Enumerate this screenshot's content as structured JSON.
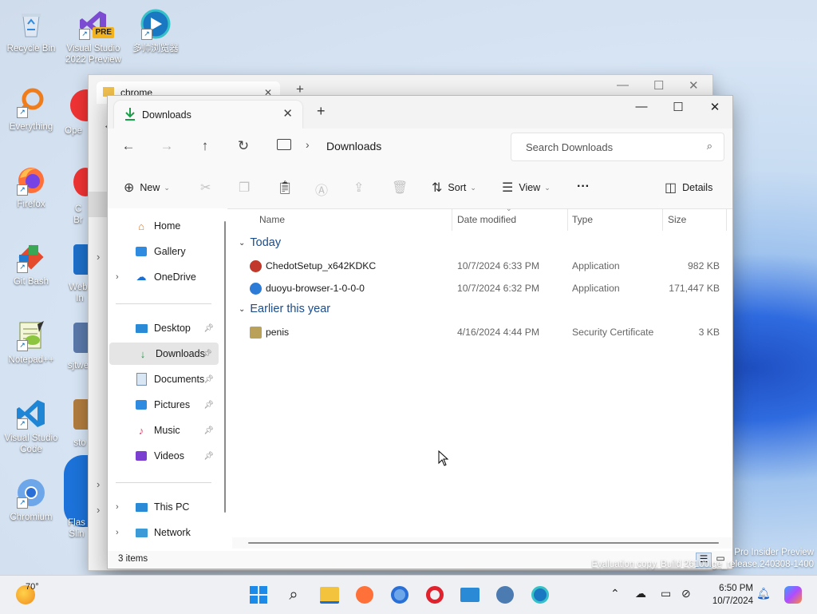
{
  "desktop": {
    "icons": [
      {
        "label": "Recycle Bin"
      },
      {
        "label": "Visual Studio 2022 Preview",
        "badge": "PRE"
      },
      {
        "label": "多帅浏览器"
      },
      {
        "label": "Everything"
      },
      {
        "label": "Firefox"
      },
      {
        "label": "Git Bash"
      },
      {
        "label": "Notepad++"
      },
      {
        "label": "Visual Studio Code"
      },
      {
        "label": "Chromium"
      }
    ],
    "partial_labels": [
      "Ope",
      "C",
      "Br",
      "Web",
      "In",
      "sjtwe",
      "sto",
      "Flas",
      "Slin"
    ],
    "watermark_line1": "Pro Insider Preview",
    "watermark_line2": "Evaluation copy. Build 26100.ge_release.240308-1400"
  },
  "background_window": {
    "tab_title": "chrome"
  },
  "explorer": {
    "tab_title": "Downloads",
    "address_path": "Downloads",
    "search_placeholder": "Search Downloads",
    "toolbar": {
      "new": "New",
      "sort": "Sort",
      "view": "View",
      "more": "···",
      "details": "Details"
    },
    "nav": {
      "home": "Home",
      "gallery": "Gallery",
      "onedrive": "OneDrive",
      "desktop": "Desktop",
      "downloads": "Downloads",
      "documents": "Documents",
      "pictures": "Pictures",
      "music": "Music",
      "videos": "Videos",
      "this_pc": "This PC",
      "network": "Network"
    },
    "columns": {
      "name": "Name",
      "date": "Date modified",
      "type": "Type",
      "size": "Size"
    },
    "groups": [
      {
        "title": "Today",
        "files": [
          {
            "name": "ChedotSetup_x642KDKC",
            "date": "10/7/2024 6:33 PM",
            "type": "Application",
            "size": "982 KB",
            "color": "#c0392b"
          },
          {
            "name": "duoyu-browser-1-0-0-0",
            "date": "10/7/2024 6:32 PM",
            "type": "Application",
            "size": "171,447 KB",
            "color": "#2c7bd6"
          }
        ]
      },
      {
        "title": "Earlier this year",
        "files": [
          {
            "name": "penis",
            "date": "4/16/2024 4:44 PM",
            "type": "Security Certificate",
            "size": "3 KB",
            "color": "#b9a15a"
          }
        ]
      }
    ],
    "status": "3 items"
  },
  "taskbar": {
    "weather_temp": "70°",
    "time": "6:50 PM",
    "date": "10/7/2024"
  }
}
